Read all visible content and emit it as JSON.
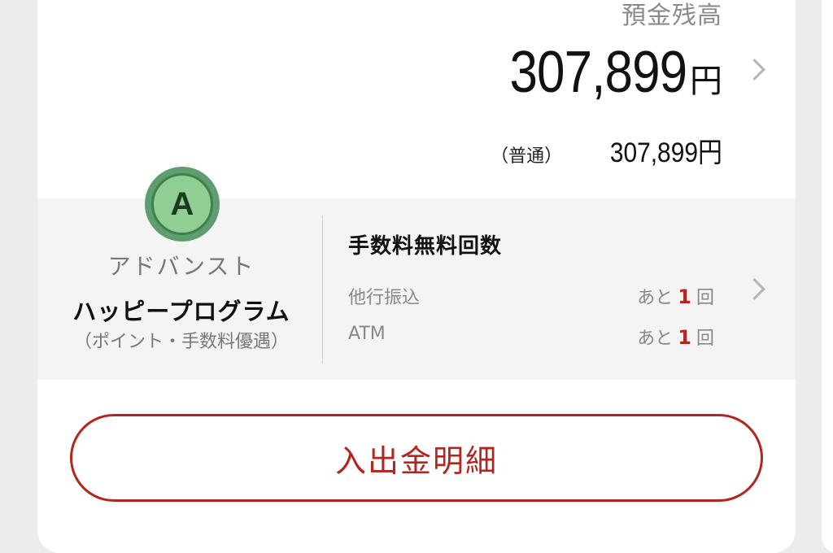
{
  "balance": {
    "label": "預金残高",
    "amount": "307,899",
    "unit": "円",
    "sub_label": "（普通）",
    "sub_amount": "307,899円"
  },
  "program": {
    "badge_letter": "A",
    "rank": "アドバンスト",
    "name": "ハッピープログラム",
    "subtitle": "（ポイント・手数料優遇）"
  },
  "fees": {
    "title": "手数料無料回数",
    "rows": [
      {
        "label": "他行振込",
        "prefix": "あと",
        "count": "1",
        "suffix": "回"
      },
      {
        "label": "ATM",
        "prefix": "あと",
        "count": "1",
        "suffix": "回"
      }
    ]
  },
  "history_button": {
    "label": "入出金明細"
  },
  "colors": {
    "accent": "#b3261e",
    "badge": "#8fcf94",
    "panel": "#f4f4f4"
  }
}
